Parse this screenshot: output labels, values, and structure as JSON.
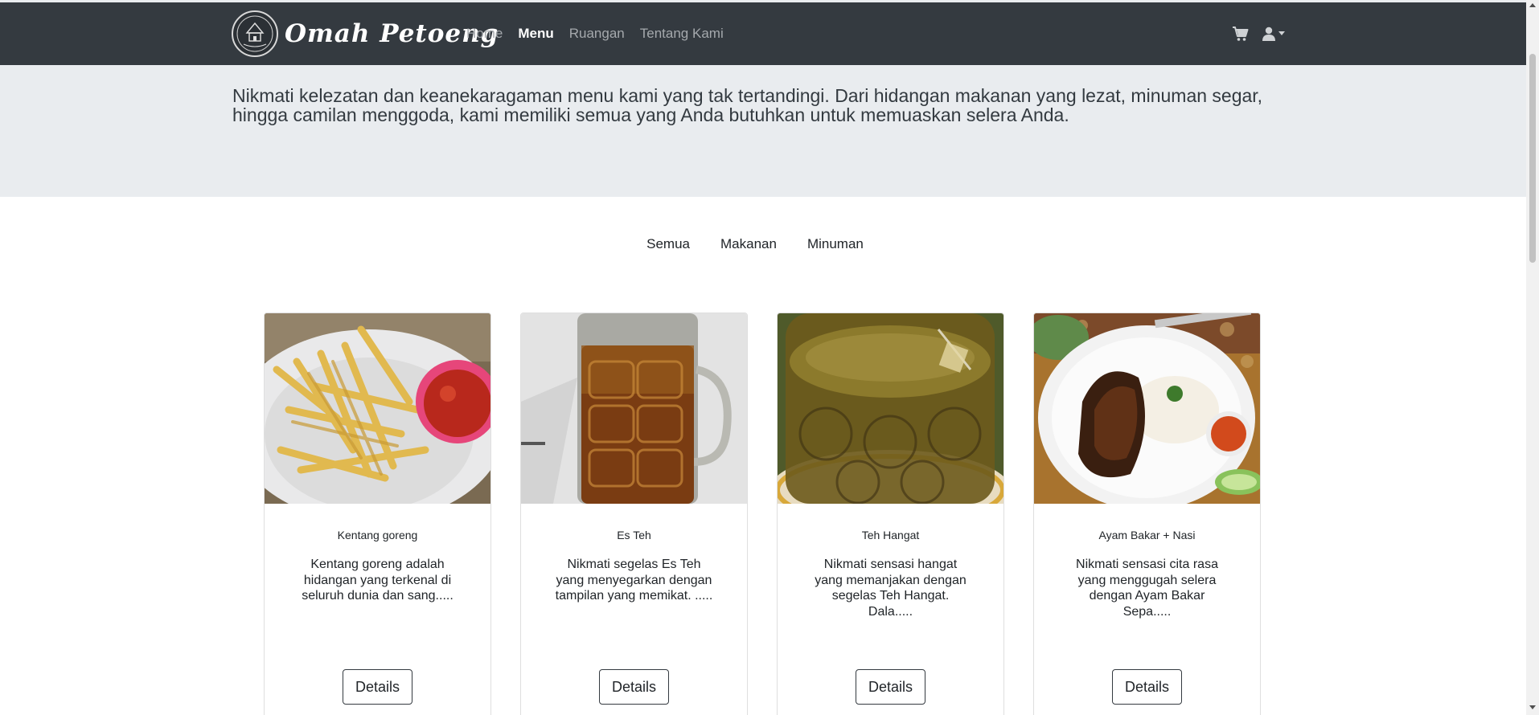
{
  "brand": {
    "name": "Omah Petoeng",
    "logo_icon": "restaurant-logo-icon"
  },
  "nav": {
    "links": [
      {
        "label": "Home",
        "active": false
      },
      {
        "label": "Menu",
        "active": true
      },
      {
        "label": "Ruangan",
        "active": false
      },
      {
        "label": "Tentang Kami",
        "active": false
      }
    ],
    "cart_icon": "cart-icon",
    "user_icon": "user-dropdown-icon"
  },
  "hero": {
    "text": "Nikmati kelezatan dan keanekaragaman menu kami yang tak tertandingi. Dari hidangan makanan yang lezat, minuman segar, hingga camilan menggoda, kami memiliki semua yang Anda butuhkan untuk memuaskan selera Anda."
  },
  "filters": [
    "Semua",
    "Makanan",
    "Minuman"
  ],
  "cards": [
    {
      "title": "Kentang goreng",
      "desc": "Kentang goreng adalah hidangan yang terkenal di seluruh dunia dan sang.....",
      "button": "Details",
      "image": "french-fries-with-ketchup"
    },
    {
      "title": "Es Teh",
      "desc": "Nikmati segelas Es Teh yang menyegarkan dengan tampilan yang memikat. .....",
      "button": "Details",
      "image": "iced-tea-mug"
    },
    {
      "title": "Teh Hangat",
      "desc": "Nikmati sensasi hangat yang memanjakan dengan segelas Teh Hangat. Dala.....",
      "button": "Details",
      "image": "hot-tea-glass"
    },
    {
      "title": "Ayam Bakar + Nasi",
      "desc": "Nikmati sensasi cita rasa yang menggugah selera dengan Ayam Bakar Sepa.....",
      "button": "Details",
      "image": "grilled-chicken-rice-plate"
    }
  ],
  "colors": {
    "navbar": "#343a40",
    "hero_bg": "#e9ecef",
    "nav_link": "#a5a9ad",
    "nav_link_active": "#ffffff"
  }
}
